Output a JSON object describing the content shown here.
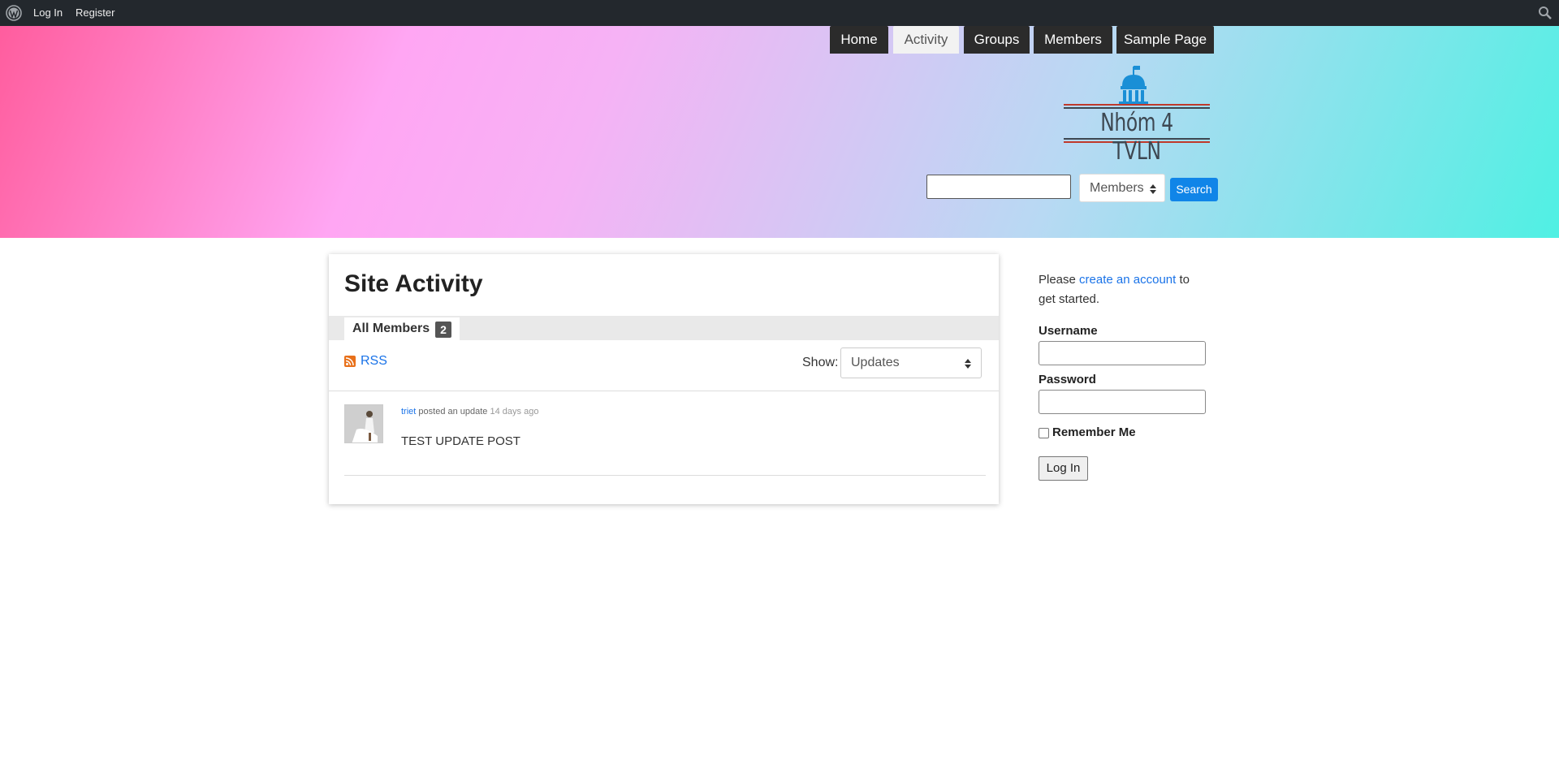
{
  "adminbar": {
    "login_label": "Log In",
    "register_label": "Register",
    "logo_icon": "wordpress-icon",
    "search_icon": "search-icon"
  },
  "header": {
    "site_title": "Nhóm 4 TVLN",
    "logo_icon": "government-building-icon",
    "search": {
      "input_value": "",
      "select_value": "Members",
      "button_label": "Search"
    },
    "nav": [
      {
        "label": "Home",
        "active": false
      },
      {
        "label": "Activity",
        "active": true
      },
      {
        "label": "Groups",
        "active": false
      },
      {
        "label": "Members",
        "active": false
      },
      {
        "label": "Sample Page",
        "active": false
      }
    ]
  },
  "main": {
    "title": "Site Activity",
    "tab": {
      "label": "All Members",
      "count": "2"
    },
    "rss_label": "RSS",
    "show_label": "Show:",
    "show_value": "Updates",
    "activity": [
      {
        "user": "triet",
        "action": "posted an update",
        "time": "14 days ago",
        "content": "TEST UPDATE POST"
      }
    ]
  },
  "sidebar": {
    "intro_before": "Please ",
    "intro_link": "create an account",
    "intro_after": " to get started.",
    "username_label": "Username",
    "password_label": "Password",
    "remember_label": "Remember Me",
    "login_button": "Log In"
  },
  "colors": {
    "adminbar_bg": "#23282d",
    "accent_blue": "#1085e8",
    "nav_dark": "#2b2b2b",
    "link_blue": "#1a73e8"
  }
}
